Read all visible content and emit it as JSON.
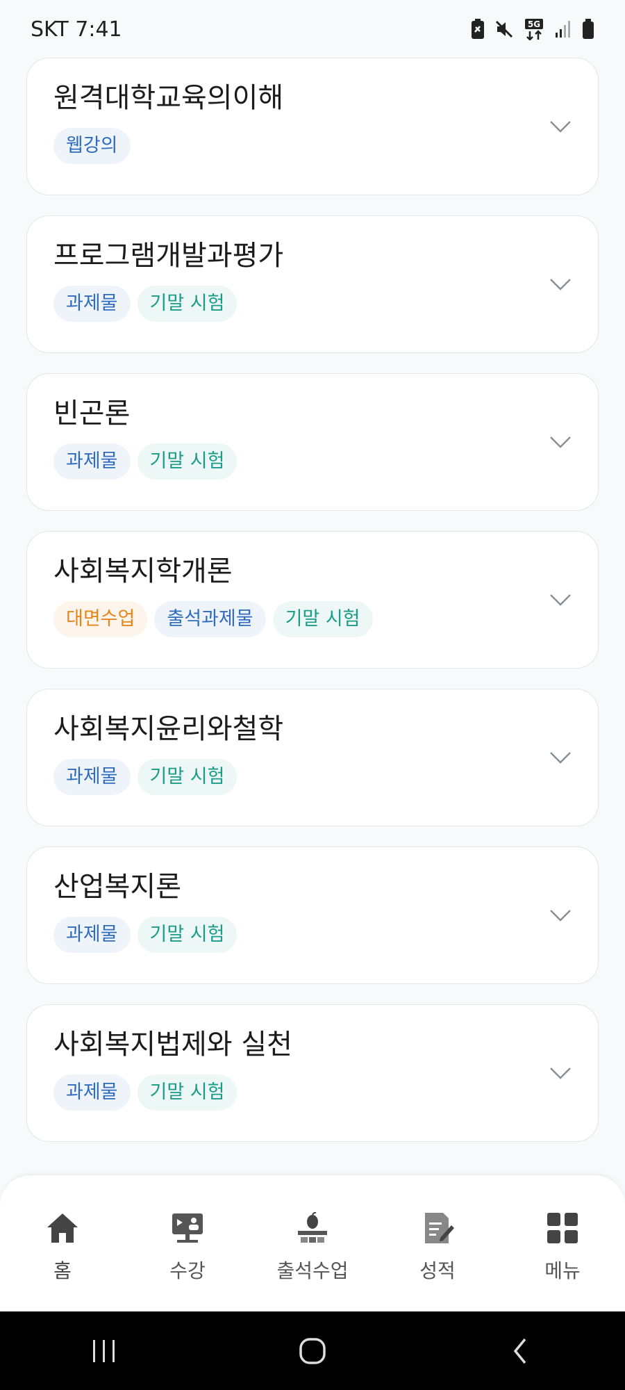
{
  "status": {
    "carrier_time": "SKT 7:41"
  },
  "courses": [
    {
      "title": "원격대학교육의이해",
      "tags": [
        {
          "label": "웹강의",
          "color": "blue"
        }
      ]
    },
    {
      "title": "프로그램개발과평가",
      "tags": [
        {
          "label": "과제물",
          "color": "blue"
        },
        {
          "label": "기말 시험",
          "color": "teal"
        }
      ]
    },
    {
      "title": "빈곤론",
      "tags": [
        {
          "label": "과제물",
          "color": "blue"
        },
        {
          "label": "기말 시험",
          "color": "teal"
        }
      ]
    },
    {
      "title": "사회복지학개론",
      "tags": [
        {
          "label": "대면수업",
          "color": "orange"
        },
        {
          "label": "출석과제물",
          "color": "blue"
        },
        {
          "label": "기말 시험",
          "color": "teal"
        }
      ]
    },
    {
      "title": "사회복지윤리와철학",
      "tags": [
        {
          "label": "과제물",
          "color": "blue"
        },
        {
          "label": "기말 시험",
          "color": "teal"
        }
      ]
    },
    {
      "title": "산업복지론",
      "tags": [
        {
          "label": "과제물",
          "color": "blue"
        },
        {
          "label": "기말 시험",
          "color": "teal"
        }
      ]
    },
    {
      "title": "사회복지법제와 실천",
      "tags": [
        {
          "label": "과제물",
          "color": "blue"
        },
        {
          "label": "기말 시험",
          "color": "teal"
        }
      ]
    }
  ],
  "nav": [
    {
      "label": "홈",
      "icon": "home-icon"
    },
    {
      "label": "수강",
      "icon": "lecture-monitor-icon"
    },
    {
      "label": "출석수업",
      "icon": "attendance-class-icon"
    },
    {
      "label": "성적",
      "icon": "grade-document-icon"
    },
    {
      "label": "메뉴",
      "icon": "grid-menu-icon"
    }
  ],
  "colors": {
    "tag_blue_text": "#2f6bbf",
    "tag_teal_text": "#1a9c89",
    "tag_orange_text": "#e8851a",
    "nav_icon": "#444444"
  }
}
